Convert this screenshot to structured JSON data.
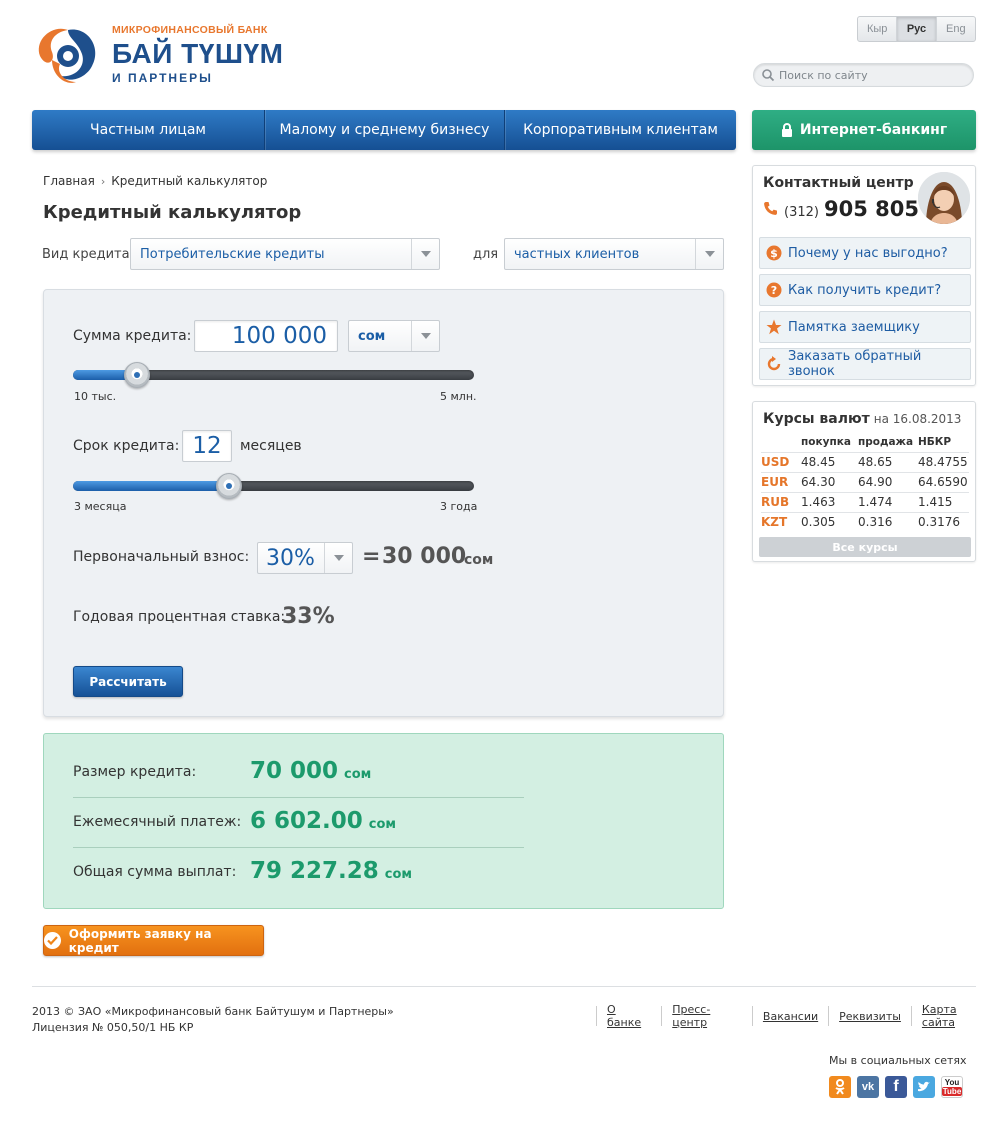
{
  "header": {
    "logo_subtitle": "МИКРОФИНАНСОВЫЙ БАНК",
    "logo_name": "БАЙ ТҮШҮМ",
    "logo_partners": "И ПАРТНЕРЫ",
    "languages": [
      "Кыр",
      "Рус",
      "Eng"
    ],
    "active_language": "Рус",
    "search_placeholder": "Поиск по сайту"
  },
  "nav": {
    "items": [
      "Частным лицам",
      "Малому и среднему бизнесу",
      "Корпоративным клиентам"
    ],
    "internet_banking": "Интернет-банкинг"
  },
  "breadcrumb": {
    "home": "Главная",
    "current": "Кредитный калькулятор"
  },
  "page_title": "Кредитный калькулятор",
  "filters": {
    "type_label": "Вид кредита",
    "type_value": "Потребительские кредиты",
    "for_label": "для",
    "for_value": "частных клиентов"
  },
  "calculator": {
    "amount_label": "Сумма кредита:",
    "amount_value": "100 000",
    "currency_value": "сом",
    "amount_min": "10 тыс.",
    "amount_max": "5 млн.",
    "amount_slider_fraction": 0.16,
    "term_label": "Срок кредита:",
    "term_value": "12",
    "term_unit": "месяцев",
    "term_min": "3 месяца",
    "term_max": "3 года",
    "term_slider_fraction": 0.39,
    "down_label": "Первоначальный взнос:",
    "down_percent": "30%",
    "down_equals": "=",
    "down_amount": "30 000",
    "down_currency": "сом",
    "rate_label": "Годовая процентная ставка:",
    "rate_value": "33%",
    "calc_button": "Рассчитать"
  },
  "results": {
    "loan_label": "Размер кредита:",
    "loan_value": "70 000",
    "monthly_label": "Ежемесячный платеж:",
    "monthly_value": "6 602.00",
    "total_label": "Общая сумма выплат:",
    "total_value": "79 227.28",
    "currency": "сом"
  },
  "apply_button": "Оформить заявку на кредит",
  "contact": {
    "title": "Контактный центр",
    "phone_code": "(312)",
    "phone_number": "905 805",
    "links": [
      "Почему у нас выгодно?",
      "Как получить кредит?",
      "Памятка заемщику",
      "Заказать обратный звонок"
    ]
  },
  "rates": {
    "title": "Курсы валют",
    "date": "на 16.08.2013",
    "headers": [
      "покупка",
      "продажа",
      "НБКР"
    ],
    "rows": [
      {
        "cur": "USD",
        "buy": "48.45",
        "sell": "48.65",
        "nbkr": "48.4755"
      },
      {
        "cur": "EUR",
        "buy": "64.30",
        "sell": "64.90",
        "nbkr": "64.6590"
      },
      {
        "cur": "RUB",
        "buy": "1.463",
        "sell": "1.474",
        "nbkr": "1.415"
      },
      {
        "cur": "KZT",
        "buy": "0.305",
        "sell": "0.316",
        "nbkr": "0.3176"
      }
    ],
    "all_rates": "Все курсы"
  },
  "footer": {
    "copyright": "2013 © ЗАО «Микрофинансовый банк Байтушум и Партнеры»",
    "license": "Лицензия № 050,50/1 НБ КР",
    "links": [
      "О банке",
      "Пресс-центр",
      "Вакансии",
      "Реквизиты",
      "Карта сайта"
    ],
    "social_label": "Мы в социальных сетях",
    "social": [
      "odnoklassniki-icon",
      "vkontakte-icon",
      "facebook-icon",
      "twitter-icon",
      "youtube-icon"
    ]
  },
  "colors": {
    "brand_blue": "#1e4f8c",
    "accent_orange": "#e8772e",
    "result_green": "#1c9a6c",
    "nav_blue": "#1b5ea6",
    "ib_green": "#23a074"
  }
}
